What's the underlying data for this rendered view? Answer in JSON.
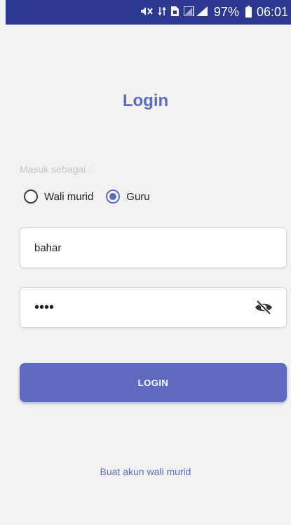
{
  "status_bar": {
    "battery": "97%",
    "time": "06:01",
    "icons": [
      "mute-icon",
      "data-transfer-icon",
      "sim-icon",
      "signal-icon",
      "battery-icon"
    ]
  },
  "title": "Login",
  "login_as_label": "Masuk sebagai :",
  "role_options": [
    {
      "label": "Wali murid",
      "checked": false
    },
    {
      "label": "Guru",
      "checked": true
    }
  ],
  "username": {
    "value": "bahar"
  },
  "password": {
    "value": "••••"
  },
  "login_button": "LOGIN",
  "create_account_link": "Buat akun wali murid",
  "colors": {
    "accent": "#5c6bc0",
    "status_bar": "#2b3990",
    "background": "#f2f2f2"
  }
}
